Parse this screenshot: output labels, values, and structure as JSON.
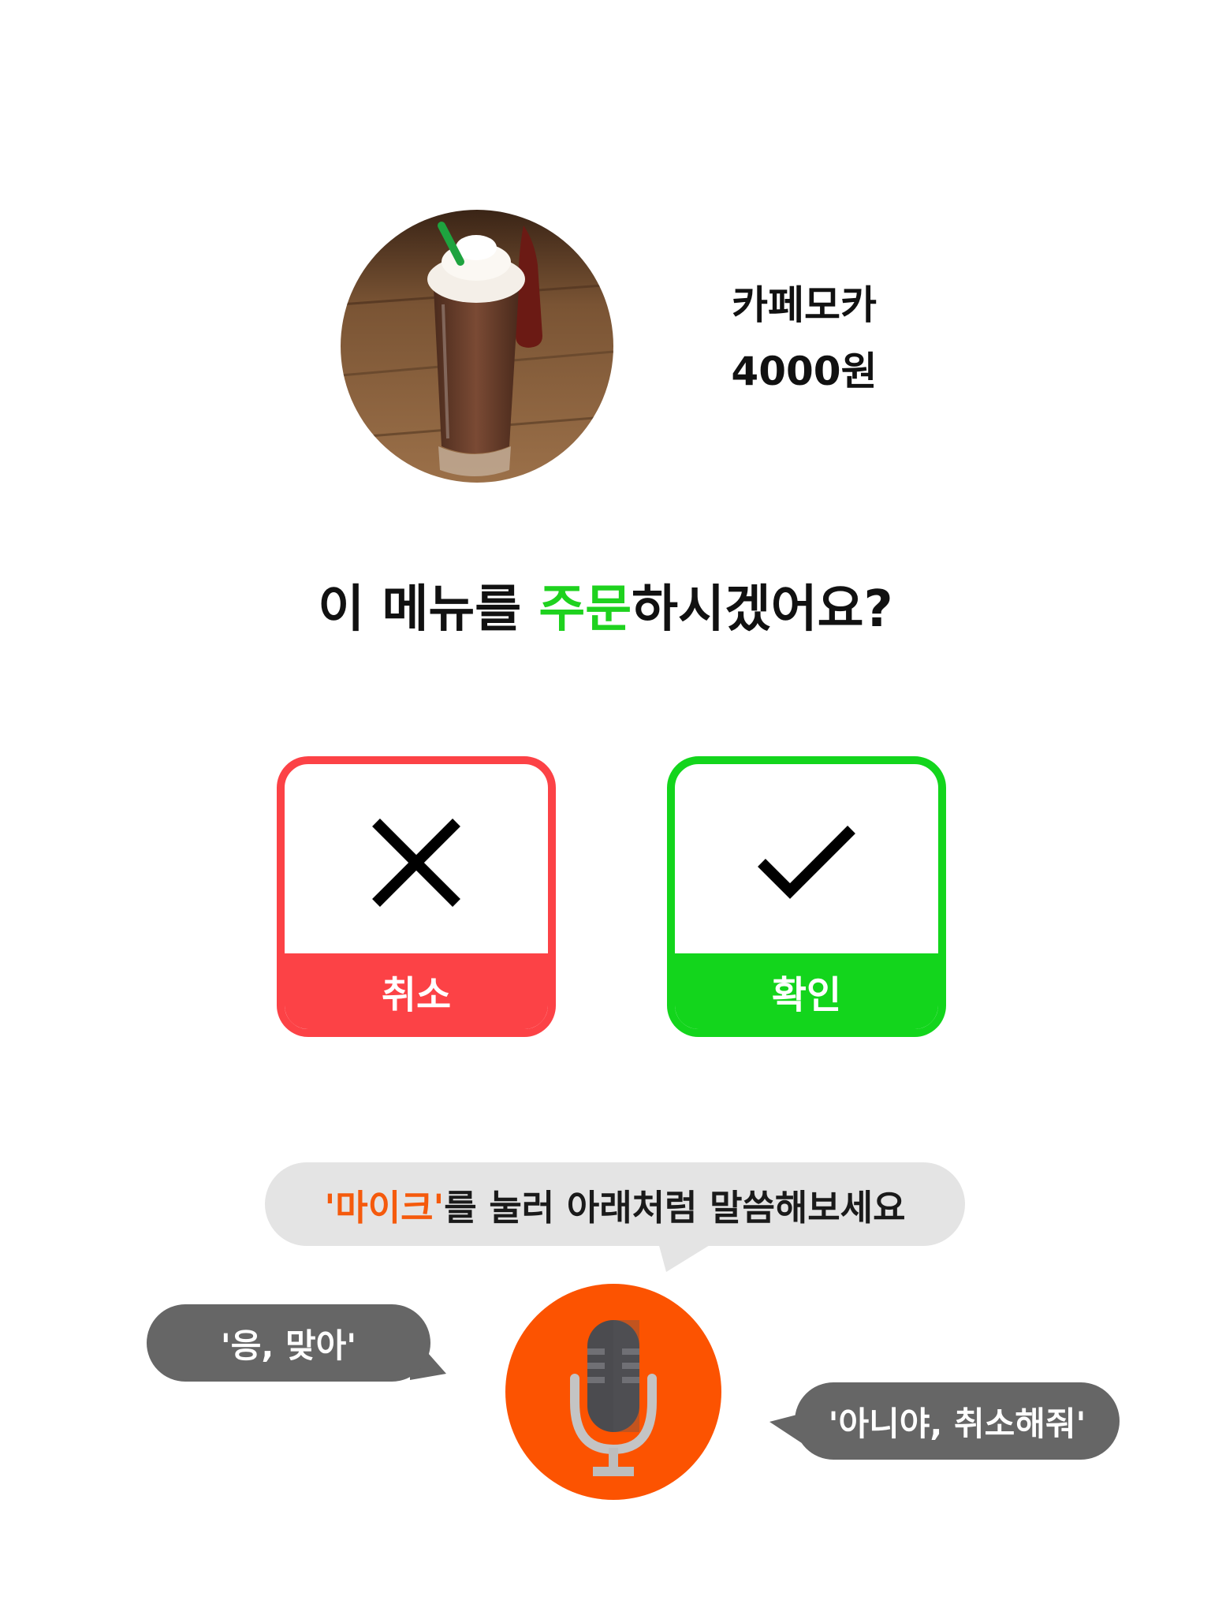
{
  "product": {
    "name": "카페모카",
    "price": "4000원",
    "image": "iced-cafe-mocha-photo"
  },
  "question": {
    "prefix": "이 메뉴를 ",
    "highlight": "주문",
    "suffix": "하시겠어요?"
  },
  "actions": {
    "cancel": {
      "label": "취소",
      "icon": "close-icon",
      "color": "#fc4246"
    },
    "confirm": {
      "label": "확인",
      "icon": "check-icon",
      "color": "#13d51c"
    }
  },
  "voice": {
    "hint_highlight": "'마이크'",
    "hint_rest": "를 눌러 아래처럼 말씀해보세요",
    "yes_phrase": "'응, 맞아'",
    "no_phrase": "'아니야, 취소해줘'",
    "mic_icon": "microphone-icon",
    "mic_color": "#fc5301"
  },
  "colors": {
    "accent_green": "#1ed21e",
    "accent_orange": "#f55a0c",
    "bubble_light": "#e4e4e4",
    "bubble_dark": "#666666"
  }
}
